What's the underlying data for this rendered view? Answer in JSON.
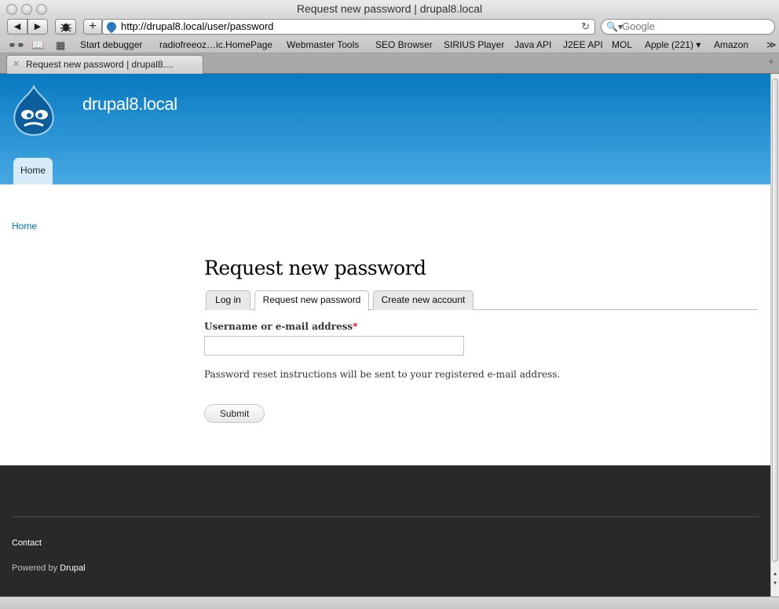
{
  "window": {
    "title": "Request new password | drupal8.local"
  },
  "toolbar": {
    "back_glyph": "◀",
    "forward_glyph": "▶",
    "add_glyph": "+",
    "url": "http://drupal8.local/user/password",
    "reload_glyph": "↻",
    "search_placeholder": "Google"
  },
  "bookmarks": {
    "items": [
      "Start debugger",
      "radiofreeoz…ic.HomePage",
      "Webmaster Tools",
      "SEO Browser",
      "SIRIUS Player",
      "Java API",
      "J2EE API",
      "MOL",
      "Apple (221) ▾",
      "Amazon"
    ],
    "overflow": "≫"
  },
  "browser_tab": {
    "label": "Request new password | drupal8....",
    "close": "✕",
    "new_tab": "+"
  },
  "site": {
    "name": "drupal8.local",
    "nav_home": "Home"
  },
  "breadcrumb": {
    "home": "Home"
  },
  "page": {
    "title": "Request new password",
    "tabs": [
      {
        "label": "Log in",
        "active": false
      },
      {
        "label": "Request new password",
        "active": true
      },
      {
        "label": "Create new account",
        "active": false
      }
    ],
    "field_label": "Username or e-mail address",
    "required_marker": "*",
    "field_value": "",
    "description": "Password reset instructions will be sent to your registered e-mail address.",
    "submit": "Submit"
  },
  "footer": {
    "contact": "Contact",
    "powered_prefix": "Powered by ",
    "powered_link": "Drupal"
  },
  "colors": {
    "header_top": "#0779bf",
    "header_bottom": "#48a9e4",
    "link": "#0071b3",
    "footer_bg": "#292929"
  }
}
